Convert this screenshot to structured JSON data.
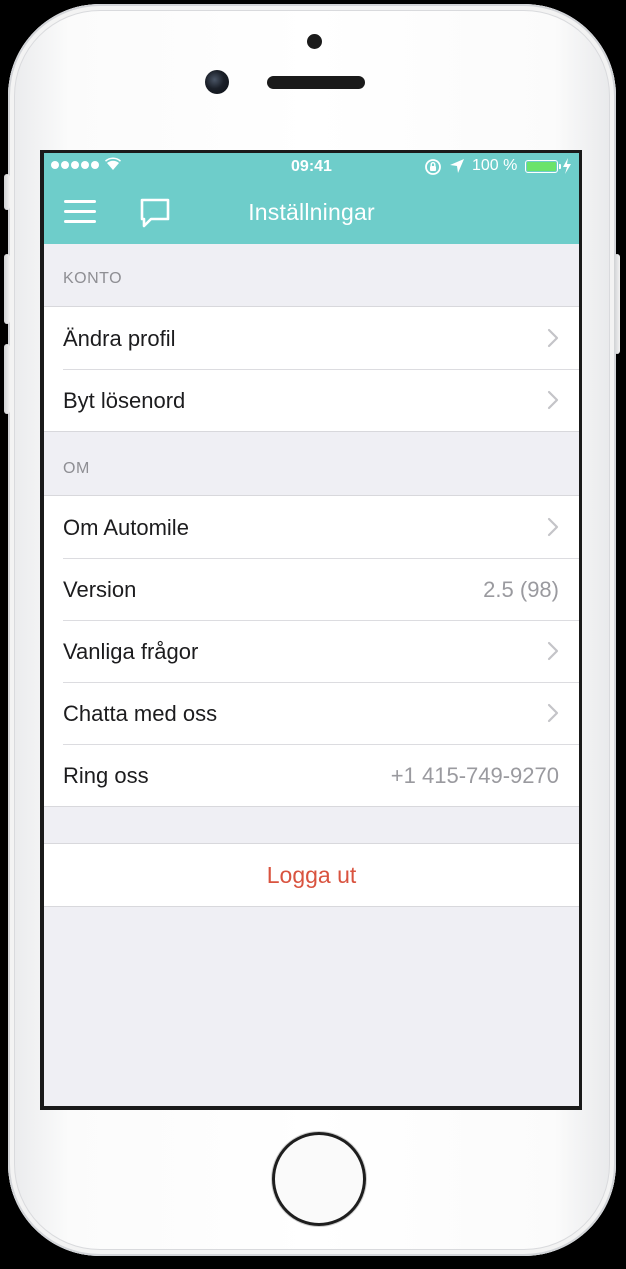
{
  "status_bar": {
    "time": "09:41",
    "battery_percent": "100 %",
    "battery_fill_fraction": 1.0,
    "battery_color": "#6be36b"
  },
  "nav": {
    "title": "Inställningar",
    "menu_icon": "hamburger-menu-icon",
    "chat_icon": "chat-bubble-icon",
    "background_color": "#6ecdca"
  },
  "sections": [
    {
      "header": "KONTO",
      "rows": [
        {
          "label": "Ändra profil",
          "accessory": "chevron"
        },
        {
          "label": "Byt lösenord",
          "accessory": "chevron"
        }
      ]
    },
    {
      "header": "OM",
      "rows": [
        {
          "label": "Om Automile",
          "accessory": "chevron"
        },
        {
          "label": "Version",
          "value": "2.5 (98)"
        },
        {
          "label": "Vanliga frågor",
          "accessory": "chevron"
        },
        {
          "label": "Chatta med oss",
          "accessory": "chevron"
        },
        {
          "label": "Ring oss",
          "value": "+1 415-749-9270"
        }
      ]
    }
  ],
  "logout": {
    "label": "Logga ut",
    "color": "#d9533f"
  }
}
